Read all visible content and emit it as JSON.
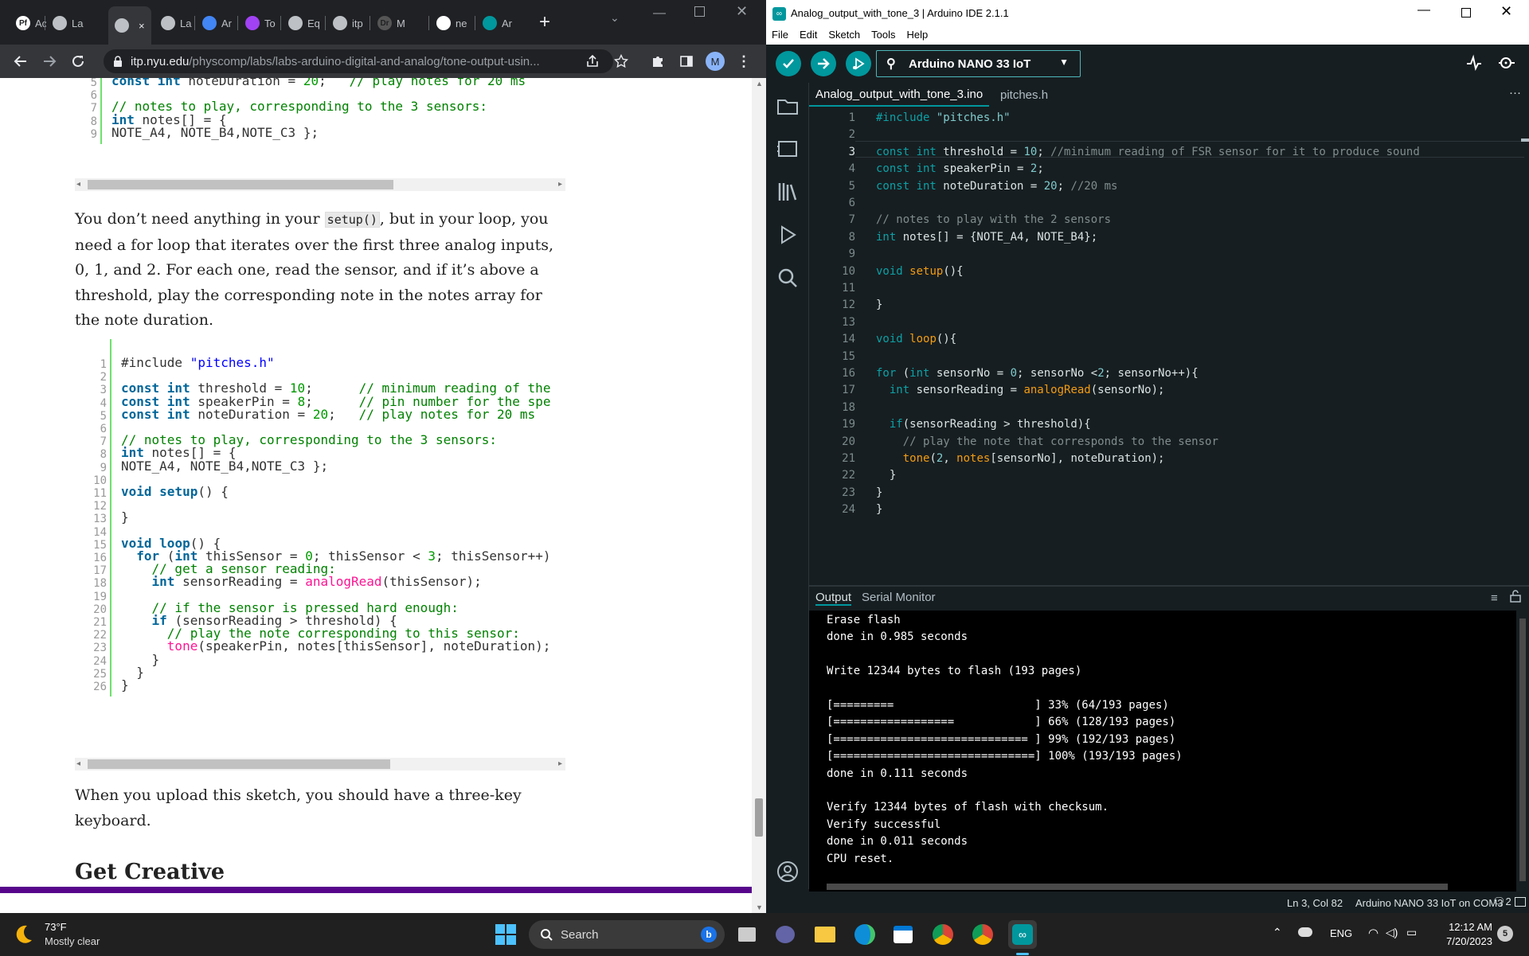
{
  "browser": {
    "tabs": [
      {
        "label": "Ac",
        "favicon": "Pf"
      },
      {
        "label": "La",
        "favicon": "globe"
      },
      {
        "label": "",
        "favicon": "globe"
      },
      {
        "label": "La",
        "favicon": "globe"
      },
      {
        "label": "Ar",
        "favicon": "docs"
      },
      {
        "label": "To",
        "favicon": "pen"
      },
      {
        "label": "Eq",
        "favicon": "globe"
      },
      {
        "label": "itp",
        "favicon": "globe"
      },
      {
        "label": "M",
        "favicon": "Dr"
      },
      {
        "label": "ne",
        "favicon": "google"
      },
      {
        "label": "Ar",
        "favicon": "arduino"
      }
    ],
    "close_glyph": "×",
    "new_tab_glyph": "+",
    "url_host": "itp.nyu.edu",
    "url_path": "/physcomp/labs/labs-arduino-digital-and-analog/tone-output-usin...",
    "profile_initial": "M",
    "icons": [
      "back-arrow",
      "forward-arrow",
      "reload",
      "lock",
      "share",
      "star",
      "puzzle-extensions",
      "side-panel",
      "kebab-menu"
    ]
  },
  "article": {
    "code1": {
      "lines": [
        {
          "n": "5",
          "tokens": [
            [
              "k",
              "const "
            ],
            [
              "k",
              "int "
            ],
            [
              "t",
              "noteDuration = "
            ],
            [
              "n",
              "20"
            ],
            [
              "t",
              ";   "
            ],
            [
              "c",
              "// play notes for 20 ms"
            ]
          ]
        },
        {
          "n": "6",
          "tokens": []
        },
        {
          "n": "7",
          "tokens": [
            [
              "c",
              "// notes to play, corresponding to the 3 sensors:"
            ]
          ]
        },
        {
          "n": "8",
          "tokens": [
            [
              "k",
              "int "
            ],
            [
              "t",
              "notes[] = {"
            ]
          ]
        },
        {
          "n": "9",
          "tokens": [
            [
              "t",
              "NOTE_A4, NOTE_B4,NOTE_C3 };"
            ]
          ]
        }
      ]
    },
    "para1_parts": [
      "You don’t need anything in your ",
      "setup()",
      ", but in your loop, you need a for loop that iterates over the first three analog inputs, 0, 1, and 2. For each one, read the sensor, and if it’s above a threshold, play the corresponding note in the notes array for the note duration."
    ],
    "code2": {
      "lines": [
        {
          "n": "1",
          "tokens": [
            [
              "t",
              "#include "
            ],
            [
              "s",
              "\"pitches.h\""
            ]
          ]
        },
        {
          "n": "2",
          "tokens": []
        },
        {
          "n": "3",
          "tokens": [
            [
              "k",
              "const "
            ],
            [
              "k",
              "int "
            ],
            [
              "t",
              "threshold = "
            ],
            [
              "n",
              "10"
            ],
            [
              "t",
              ";      "
            ],
            [
              "c",
              "// minimum reading of the"
            ]
          ]
        },
        {
          "n": "4",
          "tokens": [
            [
              "k",
              "const "
            ],
            [
              "k",
              "int "
            ],
            [
              "t",
              "speakerPin = "
            ],
            [
              "n",
              "8"
            ],
            [
              "t",
              ";      "
            ],
            [
              "c",
              "// pin number for the spe"
            ]
          ]
        },
        {
          "n": "5",
          "tokens": [
            [
              "k",
              "const "
            ],
            [
              "k",
              "int "
            ],
            [
              "t",
              "noteDuration = "
            ],
            [
              "n",
              "20"
            ],
            [
              "t",
              ";   "
            ],
            [
              "c",
              "// play notes for 20 ms"
            ]
          ]
        },
        {
          "n": "6",
          "tokens": []
        },
        {
          "n": "7",
          "tokens": [
            [
              "c",
              "// notes to play, corresponding to the 3 sensors:"
            ]
          ]
        },
        {
          "n": "8",
          "tokens": [
            [
              "k",
              "int "
            ],
            [
              "t",
              "notes[] = {"
            ]
          ]
        },
        {
          "n": "9",
          "tokens": [
            [
              "t",
              "NOTE_A4, NOTE_B4,NOTE_C3 };"
            ]
          ]
        },
        {
          "n": "10",
          "tokens": []
        },
        {
          "n": "11",
          "tokens": [
            [
              "k",
              "void "
            ],
            [
              "k",
              "setup"
            ],
            [
              "t",
              "() {"
            ]
          ]
        },
        {
          "n": "12",
          "tokens": []
        },
        {
          "n": "13",
          "tokens": [
            [
              "t",
              "}"
            ]
          ]
        },
        {
          "n": "14",
          "tokens": []
        },
        {
          "n": "15",
          "tokens": [
            [
              "k",
              "void "
            ],
            [
              "k",
              "loop"
            ],
            [
              "t",
              "() {"
            ]
          ]
        },
        {
          "n": "16",
          "tokens": [
            [
              "t",
              "  "
            ],
            [
              "k",
              "for "
            ],
            [
              "t",
              "("
            ],
            [
              "k",
              "int "
            ],
            [
              "t",
              "thisSensor = "
            ],
            [
              "n",
              "0"
            ],
            [
              "t",
              "; thisSensor < "
            ],
            [
              "n",
              "3"
            ],
            [
              "t",
              "; thisSensor++)"
            ]
          ]
        },
        {
          "n": "17",
          "tokens": [
            [
              "t",
              "    "
            ],
            [
              "c",
              "// get a sensor reading:"
            ]
          ]
        },
        {
          "n": "18",
          "tokens": [
            [
              "t",
              "    "
            ],
            [
              "k",
              "int "
            ],
            [
              "t",
              "sensorReading = "
            ],
            [
              "f",
              "analogRead"
            ],
            [
              "t",
              "(thisSensor);"
            ]
          ]
        },
        {
          "n": "19",
          "tokens": []
        },
        {
          "n": "20",
          "tokens": [
            [
              "t",
              "    "
            ],
            [
              "c",
              "// if the sensor is pressed hard enough:"
            ]
          ]
        },
        {
          "n": "21",
          "tokens": [
            [
              "t",
              "    "
            ],
            [
              "k",
              "if "
            ],
            [
              "t",
              "(sensorReading > threshold) {"
            ]
          ]
        },
        {
          "n": "22",
          "tokens": [
            [
              "t",
              "      "
            ],
            [
              "c",
              "// play the note corresponding to this sensor:"
            ]
          ]
        },
        {
          "n": "23",
          "tokens": [
            [
              "t",
              "      "
            ],
            [
              "f",
              "tone"
            ],
            [
              "t",
              "(speakerPin, notes[thisSensor], noteDuration);"
            ]
          ]
        },
        {
          "n": "24",
          "tokens": [
            [
              "t",
              "    }"
            ]
          ]
        },
        {
          "n": "25",
          "tokens": [
            [
              "t",
              "  }"
            ]
          ]
        },
        {
          "n": "26",
          "tokens": [
            [
              "t",
              "}"
            ]
          ]
        }
      ]
    },
    "para2": "When you upload this sketch, you should have a three-key keyboard.",
    "heading": "Get Creative"
  },
  "ide": {
    "title": "Analog_output_with_tone_3 | Arduino IDE 2.1.1",
    "menu": [
      "File",
      "Edit",
      "Sketch",
      "Tools",
      "Help"
    ],
    "board": "Arduino NANO 33 IoT",
    "file_tabs": [
      "Analog_output_with_tone_3.ino",
      "pitches.h"
    ],
    "more_glyph": "···",
    "editor_lines": [
      {
        "n": "1",
        "tokens": [
          [
            "ek",
            "#include "
          ],
          [
            "es",
            "\"pitches.h\""
          ]
        ]
      },
      {
        "n": "2",
        "tokens": []
      },
      {
        "n": "3",
        "tokens": [
          [
            "ek",
            "const "
          ],
          [
            "ek",
            "int "
          ],
          [
            "et",
            "threshold = "
          ],
          [
            "es",
            "10"
          ],
          [
            "et",
            "; "
          ],
          [
            "ec",
            "//minimum reading of FSR sensor for it to produce sound"
          ]
        ]
      },
      {
        "n": "4",
        "tokens": [
          [
            "ek",
            "const "
          ],
          [
            "ek",
            "int "
          ],
          [
            "et",
            "speakerPin = "
          ],
          [
            "es",
            "2"
          ],
          [
            "et",
            ";"
          ]
        ]
      },
      {
        "n": "5",
        "tokens": [
          [
            "ek",
            "const "
          ],
          [
            "ek",
            "int "
          ],
          [
            "et",
            "noteDuration = "
          ],
          [
            "es",
            "20"
          ],
          [
            "et",
            "; "
          ],
          [
            "ec",
            "//20 ms"
          ]
        ]
      },
      {
        "n": "6",
        "tokens": []
      },
      {
        "n": "7",
        "tokens": [
          [
            "ec",
            "// notes to play with the 2 sensors"
          ]
        ]
      },
      {
        "n": "8",
        "tokens": [
          [
            "ek",
            "int "
          ],
          [
            "et",
            "notes[] = {NOTE_A4, NOTE_B4};"
          ]
        ]
      },
      {
        "n": "9",
        "tokens": []
      },
      {
        "n": "10",
        "tokens": [
          [
            "ek",
            "void "
          ],
          [
            "ef",
            "setup"
          ],
          [
            "et",
            "(){"
          ]
        ]
      },
      {
        "n": "11",
        "tokens": []
      },
      {
        "n": "12",
        "tokens": [
          [
            "et",
            "}"
          ]
        ]
      },
      {
        "n": "13",
        "tokens": []
      },
      {
        "n": "14",
        "tokens": [
          [
            "ek",
            "void "
          ],
          [
            "ef",
            "loop"
          ],
          [
            "et",
            "(){"
          ]
        ]
      },
      {
        "n": "15",
        "tokens": []
      },
      {
        "n": "16",
        "tokens": [
          [
            "ek",
            "for "
          ],
          [
            "et",
            "("
          ],
          [
            "ek",
            "int "
          ],
          [
            "et",
            "sensorNo = "
          ],
          [
            "es",
            "0"
          ],
          [
            "et",
            "; sensorNo <"
          ],
          [
            "es",
            "2"
          ],
          [
            "et",
            "; sensorNo++){"
          ]
        ]
      },
      {
        "n": "17",
        "tokens": [
          [
            "et",
            "  "
          ],
          [
            "ek",
            "int "
          ],
          [
            "et",
            "sensorReading = "
          ],
          [
            "ef",
            "analogRead"
          ],
          [
            "et",
            "(sensorNo);"
          ]
        ]
      },
      {
        "n": "18",
        "tokens": []
      },
      {
        "n": "19",
        "tokens": [
          [
            "et",
            "  "
          ],
          [
            "ek",
            "if"
          ],
          [
            "et",
            "(sensorReading > threshold){"
          ]
        ]
      },
      {
        "n": "20",
        "tokens": [
          [
            "et",
            "    "
          ],
          [
            "ec",
            "// play the note that corresponds to the sensor"
          ]
        ]
      },
      {
        "n": "21",
        "tokens": [
          [
            "et",
            "    "
          ],
          [
            "ef",
            "tone"
          ],
          [
            "et",
            "("
          ],
          [
            "es",
            "2"
          ],
          [
            "et",
            ", "
          ],
          [
            "ef",
            "notes"
          ],
          [
            "et",
            "[sensorNo], noteDuration);"
          ]
        ]
      },
      {
        "n": "22",
        "tokens": [
          [
            "et",
            "  }"
          ]
        ]
      },
      {
        "n": "23",
        "tokens": [
          [
            "et",
            "}"
          ]
        ]
      },
      {
        "n": "24",
        "tokens": [
          [
            "et",
            "}"
          ]
        ]
      }
    ],
    "output_tabs": [
      "Output",
      "Serial Monitor"
    ],
    "output_lines": [
      "Erase flash",
      "done in 0.985 seconds",
      "",
      "Write 12344 bytes to flash (193 pages)",
      "",
      "[=========                     ] 33% (64/193 pages)",
      "[==================            ] 66% (128/193 pages)",
      "[============================= ] 99% (192/193 pages)",
      "[==============================] 100% (193/193 pages)",
      "done in 0.111 seconds",
      "",
      "Verify 12344 bytes of flash with checksum.",
      "Verify successful",
      "done in 0.011 seconds",
      "CPU reset."
    ],
    "status_pos": "Ln 3, Col 82",
    "status_board": "Arduino NANO 33 IoT on COM3",
    "status_notifications": "2"
  },
  "taskbar": {
    "temp": "73°F",
    "weather": "Mostly clear",
    "search_placeholder": "Search",
    "lang": "ENG",
    "time": "12:12 AM",
    "date": "7/20/2023",
    "notif_count": "5"
  },
  "colors": {
    "arduino_teal": "#00979d",
    "ide_bg": "#171e21",
    "chrome_dark": "#202124",
    "nyu_purple": "#57068c"
  }
}
